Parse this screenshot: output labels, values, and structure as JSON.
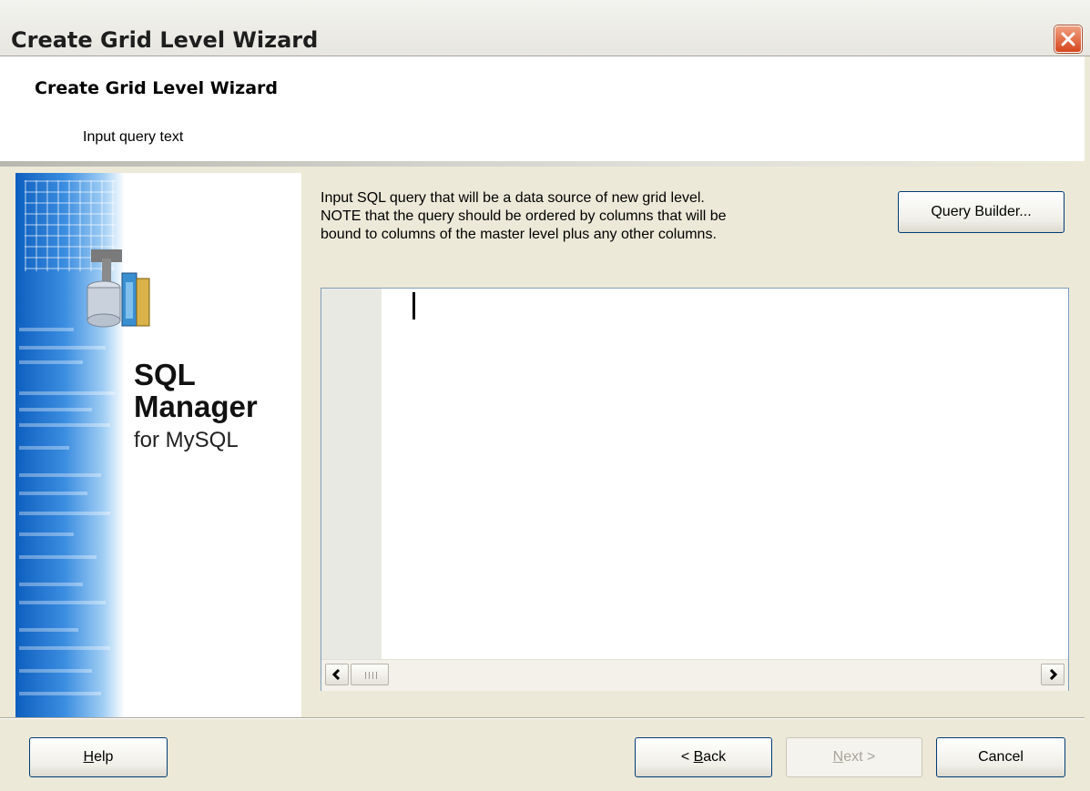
{
  "window": {
    "title": "Create Grid Level Wizard"
  },
  "header": {
    "title": "Create Grid Level Wizard",
    "subtitle": "Input query text"
  },
  "banner": {
    "brand_line1": "SQL",
    "brand_line2": "Manager",
    "brand_line3": "for MySQL",
    "icon": "database-tools-icon"
  },
  "main": {
    "instruction_lines": [
      "Input SQL query that will be a data source of new grid level.",
      "NOTE that the query should be ordered by columns that will be",
      "bound to columns of the master level plus any other columns."
    ],
    "query_builder_label": "Query Builder...",
    "editor_text": ""
  },
  "footer": {
    "help_label": "Help",
    "help_hotkey": "H",
    "back_label": "< Back",
    "back_hotkey": "B",
    "next_label": "Next >",
    "next_hotkey": "N",
    "next_enabled": false,
    "cancel_label": "Cancel"
  },
  "colors": {
    "window_bg": "#ece9d8",
    "close_button": "#d6461d",
    "banner_blue": "#0d5fbf",
    "disabled_text": "#a8a599",
    "button_border": "#003c74"
  }
}
